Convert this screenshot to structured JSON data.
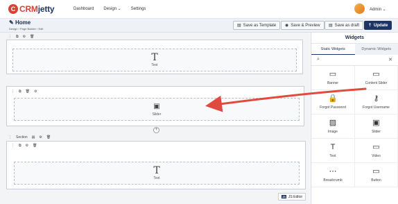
{
  "app": {
    "logo_mark": "C",
    "logo_crm": "CRM",
    "logo_jetty": "jetty"
  },
  "nav": [
    {
      "label": "Dashboard"
    },
    {
      "label": "Design ⌄"
    },
    {
      "label": "Settings"
    }
  ],
  "user": {
    "name": "Admin ⌄"
  },
  "page": {
    "title": "Home",
    "breadcrumb": "Design  ›  Page Builder  ›  Edit"
  },
  "header_buttons": {
    "template": "Save as Template",
    "preview": "Save & Preview",
    "draft": "Save as draft",
    "update": "Update"
  },
  "canvas": {
    "section_label": "Section",
    "blocks": [
      {
        "label": "Text"
      },
      {
        "label": "Slider"
      },
      {
        "label": "Text"
      }
    ],
    "add_symbol": "+",
    "js_badge": "JS",
    "js_label": "JS Editor"
  },
  "panel": {
    "title": "Widgets",
    "tabs": [
      "Static Widgets",
      "Dynamic Widgets"
    ],
    "search_placeholder": "",
    "widgets": [
      {
        "label": "Banner",
        "icon": "banner-icon",
        "glyph": "▭"
      },
      {
        "label": "Content Slider",
        "icon": "content-slider-icon",
        "glyph": "▭"
      },
      {
        "label": "Forgot Password",
        "icon": "lock-icon",
        "glyph": "🔒"
      },
      {
        "label": "Forgot Username",
        "icon": "user-lock-icon",
        "glyph": "⚷"
      },
      {
        "label": "Image",
        "icon": "image-icon",
        "glyph": "▨"
      },
      {
        "label": "Slider",
        "icon": "slider-icon",
        "glyph": "▣"
      },
      {
        "label": "Text",
        "icon": "text-icon",
        "glyph": "T"
      },
      {
        "label": "Video",
        "icon": "video-icon",
        "glyph": "▭"
      },
      {
        "label": "Breadcrumb",
        "icon": "breadcrumb-icon",
        "glyph": "⋯"
      },
      {
        "label": "Button",
        "icon": "button-icon",
        "glyph": "▭"
      }
    ]
  },
  "colors": {
    "brand": "#1d3566",
    "accent": "#d94036",
    "arrow": "#e04a3f"
  }
}
